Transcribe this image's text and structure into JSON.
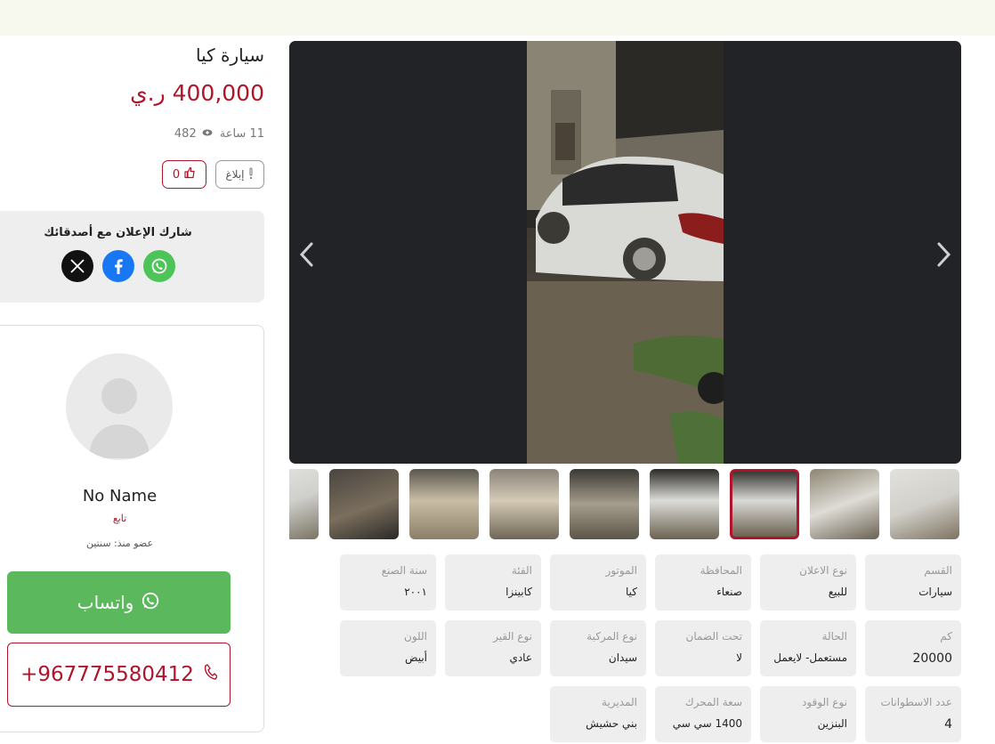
{
  "listing": {
    "title": "سيارة كيا",
    "price": "400,000 ر.ي",
    "time_ago": "11 ساعة",
    "views": "482",
    "report_label": "إبلاغ",
    "likes": "0"
  },
  "share": {
    "title": "شارك الإعلان مع أصدقائك",
    "icons": [
      "x-icon",
      "facebook-icon",
      "whatsapp-icon"
    ]
  },
  "seller": {
    "name": "No Name",
    "type": "تابع",
    "member_since": "عضو منذ: سنتين",
    "whatsapp_label": "واتساب",
    "phone": "+967775580412"
  },
  "gallery": {
    "thumbnail_count": 9,
    "active_thumbnail": 7
  },
  "specs": [
    {
      "label": "القسم",
      "value": "سيارات"
    },
    {
      "label": "نوع الاعلان",
      "value": "للبيع"
    },
    {
      "label": "المحافظة",
      "value": "صنعاء"
    },
    {
      "label": "الموتور",
      "value": "كيا"
    },
    {
      "label": "الفئة",
      "value": "كابينزا"
    },
    {
      "label": "سنة الصنع",
      "value": "٢٠٠١"
    },
    {
      "label": "كم",
      "value": "20000"
    },
    {
      "label": "الحالة",
      "value": "مستعمل- لايعمل"
    },
    {
      "label": "تحت الضمان",
      "value": "لا"
    },
    {
      "label": "نوع المركبة",
      "value": "سيدان"
    },
    {
      "label": "نوع القير",
      "value": "عادي"
    },
    {
      "label": "اللون",
      "value": "أبيض"
    },
    {
      "label": "عدد الاسطوانات",
      "value": "4"
    },
    {
      "label": "نوع الوقود",
      "value": "البنزين"
    },
    {
      "label": "سعة المحرك",
      "value": "1400 سي سي"
    },
    {
      "label": "المديرية",
      "value": "بني حشيش"
    }
  ],
  "colors": {
    "accent": "#b0142b",
    "whatsapp": "#5cb85c",
    "facebook": "#1877f2",
    "x": "#111111",
    "panel": "#eeeeee"
  }
}
